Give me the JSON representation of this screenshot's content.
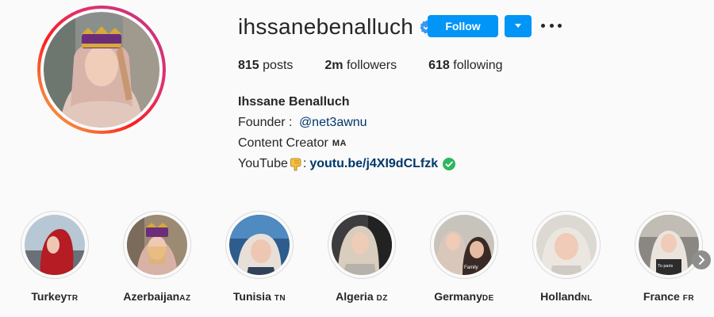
{
  "profile": {
    "username": "ihssanebenalluch",
    "verified_icon": "verified-badge-icon",
    "avatar": "profile-photo"
  },
  "actions": {
    "follow_label": "Follow",
    "dropdown_icon": "caret-down-icon",
    "more_icon": "more-options-icon"
  },
  "stats": {
    "posts_count": "815",
    "posts_label": "posts",
    "followers_count": "2m",
    "followers_label": "followers",
    "following_count": "618",
    "following_label": "following"
  },
  "bio": {
    "full_name": "Ihssane Benalluch",
    "founder_prefix": "Founder : ",
    "founder_handle": "@net3awnu",
    "creator_text": "Content Creator",
    "creator_country": "MA",
    "youtube_prefix": "YouTube",
    "youtube_colon": ":",
    "youtube_link": "youtu.be/j4XI9dCLfzk"
  },
  "highlights": [
    {
      "name": "Turkey",
      "code": "TR"
    },
    {
      "name": "Azerbaijan",
      "code": "AZ"
    },
    {
      "name": "Tunisia ",
      "code": "TN"
    },
    {
      "name": "Algeria ",
      "code": "DZ"
    },
    {
      "name": "Germany",
      "code": "DE"
    },
    {
      "name": "Holland",
      "code": "NL"
    },
    {
      "name": "France ",
      "code": "FR"
    }
  ],
  "highlight_overlays": {
    "germany": "Family",
    "france": "To paris"
  },
  "colors": {
    "follow_blue": "#0095f6",
    "link_blue": "#00376b",
    "verified_blue": "#3897f0",
    "check_green": "#2bb75c"
  }
}
